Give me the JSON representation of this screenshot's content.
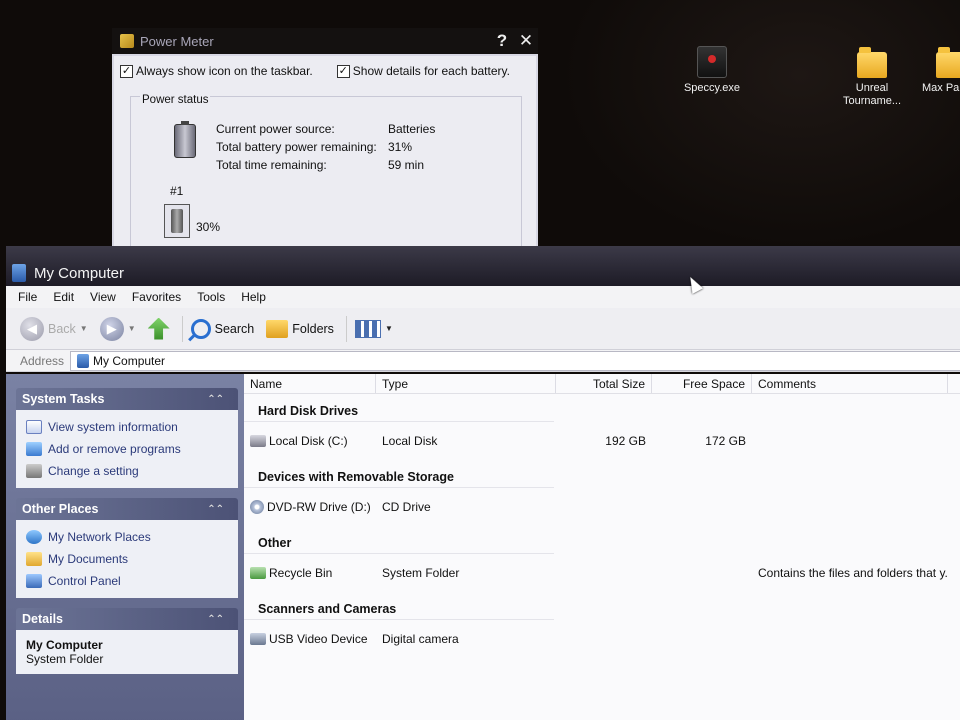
{
  "desktop": {
    "icons": [
      {
        "label": "Speccy.exe",
        "icon": "speccy-icon"
      },
      {
        "label": "Unreal Tourname...",
        "icon": "folder-icon"
      },
      {
        "label": "Max Pa",
        "icon": "folder-icon"
      }
    ]
  },
  "power_meter": {
    "title": "Power Meter",
    "help_button": "?",
    "close_button": "✕",
    "checkbox_taskbar": {
      "label": "Always show icon on the taskbar.",
      "checked": true
    },
    "checkbox_details": {
      "label": "Show details for each battery.",
      "checked": true
    },
    "group_label": "Power status",
    "stats": [
      {
        "label": "Current power source:",
        "value": "Batteries"
      },
      {
        "label": "Total battery power remaining:",
        "value": "31%"
      },
      {
        "label": "Total time remaining:",
        "value": "59 min"
      }
    ],
    "battery_number": "#1",
    "battery_percent": "30%"
  },
  "my_computer": {
    "title": "My Computer",
    "menu": [
      "File",
      "Edit",
      "View",
      "Favorites",
      "Tools",
      "Help"
    ],
    "toolbar": {
      "back": "Back",
      "search": "Search",
      "folders": "Folders"
    },
    "address_label": "Address",
    "address_value": "My Computer",
    "columns": [
      "Name",
      "Type",
      "Total Size",
      "Free Space",
      "Comments"
    ],
    "system_tasks": {
      "title": "System Tasks",
      "items": [
        "View system information",
        "Add or remove programs",
        "Change a setting"
      ]
    },
    "other_places": {
      "title": "Other Places",
      "items": [
        "My Network Places",
        "My Documents",
        "Control Panel"
      ]
    },
    "details": {
      "title": "Details",
      "name": "My Computer",
      "type": "System Folder"
    },
    "groups": [
      {
        "title": "Hard Disk Drives",
        "rows": [
          {
            "name": "Local Disk (C:)",
            "type": "Local Disk",
            "total": "192 GB",
            "free": "172 GB",
            "comment": ""
          }
        ]
      },
      {
        "title": "Devices with Removable Storage",
        "rows": [
          {
            "name": "DVD-RW Drive (D:)",
            "type": "CD Drive",
            "total": "",
            "free": "",
            "comment": ""
          }
        ]
      },
      {
        "title": "Other",
        "rows": [
          {
            "name": "Recycle Bin",
            "type": "System Folder",
            "total": "",
            "free": "",
            "comment": "Contains the files and folders that y..."
          }
        ]
      },
      {
        "title": "Scanners and Cameras",
        "rows": [
          {
            "name": "USB Video Device",
            "type": "Digital camera",
            "total": "",
            "free": "",
            "comment": ""
          }
        ]
      }
    ]
  }
}
